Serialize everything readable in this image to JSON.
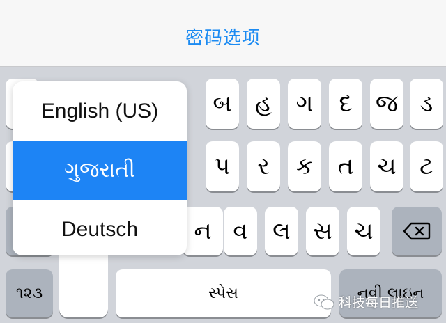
{
  "header": {
    "title": "密码选项"
  },
  "keyboard": {
    "row1": [
      "ૈ",
      "બ",
      "હ",
      "ગ",
      "દ",
      "જ",
      "ડ"
    ],
    "row2": [
      "ૂ",
      "પ",
      "ર",
      "ક",
      "ત",
      "ચ",
      "ટ"
    ],
    "row3": [
      "ન",
      "વ",
      "લ",
      "સ",
      "ચ"
    ],
    "numbers_label": "૧૨૩",
    "space_label": "સ્પેસ",
    "return_label": "નવી લાઇન",
    "delete_icon": "delete-backspace-icon"
  },
  "language_popup": {
    "options": [
      "English (US)",
      "ગુજરાતી",
      "Deutsch"
    ],
    "selected_index": 1,
    "selected_color": "#1d84f5"
  },
  "watermark": {
    "text": "科技每日推送",
    "icon": "wechat-icon"
  },
  "colors": {
    "accent": "#1c8bf2",
    "keyboard_bg": "#d1d4da",
    "function_key": "#acb3bd"
  }
}
